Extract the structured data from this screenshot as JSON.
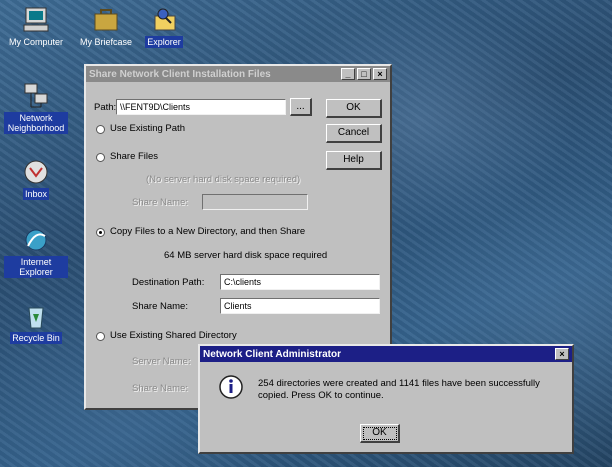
{
  "desktop": {
    "icons": [
      {
        "label": "My Computer",
        "icon": "computer-icon"
      },
      {
        "label": "My Briefcase",
        "icon": "briefcase-icon"
      },
      {
        "label": "Explorer",
        "icon": "explorer-icon"
      },
      {
        "label": "Network Neighborhood",
        "icon": "network-icon"
      },
      {
        "label": "Inbox",
        "icon": "inbox-icon"
      },
      {
        "label": "Internet Explorer",
        "icon": "internet-explorer-icon"
      },
      {
        "label": "Recycle Bin",
        "icon": "recycle-bin-icon"
      }
    ]
  },
  "share_dialog": {
    "title": "Share Network Client Installation Files",
    "path_label": "Path:",
    "path_value": "\\\\FENT9D\\Clients",
    "browse_label": "...",
    "ok_label": "OK",
    "cancel_label": "Cancel",
    "help_label": "Help",
    "opt_existing_path": "Use Existing Path",
    "opt_share_files": "Share Files",
    "share_files_note": "(No server hard disk space required)",
    "share_name_label": "Share Name:",
    "opt_copy_files": "Copy Files to a New Directory, and then Share",
    "copy_note": "64 MB  server hard disk  space required",
    "dest_path_label": "Destination Path:",
    "dest_path_value": "C:\\clients",
    "copy_share_name_label": "Share Name:",
    "copy_share_name_value": "Clients",
    "opt_existing_shared": "Use Existing Shared Directory",
    "server_name_label": "Server Name:",
    "share_name_label_2": "Share Name:"
  },
  "admin_dialog": {
    "title": "Network Client Administrator",
    "message": "254 directories were created and 1141 files have been successfully copied. Press OK to continue.",
    "ok_label": "OK",
    "icon": "information-icon"
  }
}
